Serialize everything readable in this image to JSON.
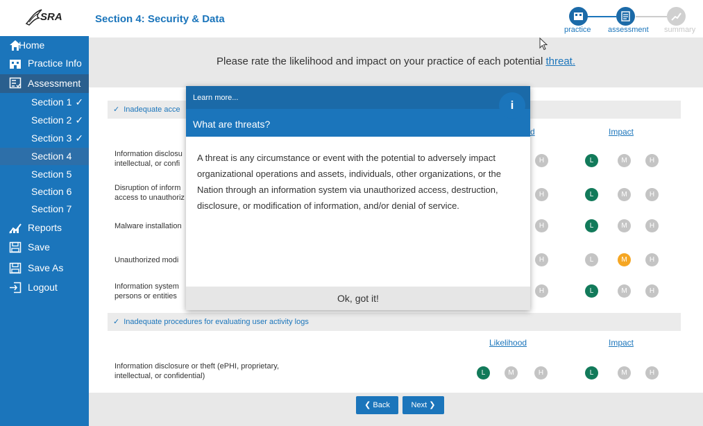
{
  "app": {
    "logo_text": "SRA",
    "section_title": "Section 4: Security & Data"
  },
  "steps": [
    {
      "label": "practice",
      "state": "done"
    },
    {
      "label": "assessment",
      "state": "active"
    },
    {
      "label": "summary",
      "state": "inactive"
    }
  ],
  "sidebar": {
    "items": [
      {
        "label": "Home",
        "icon": "home-icon"
      },
      {
        "label": "Practice Info",
        "icon": "building-icon"
      },
      {
        "label": "Assessment",
        "icon": "checklist-icon"
      },
      {
        "label": "Section 1",
        "check": "✓"
      },
      {
        "label": "Section 2",
        "check": "✓"
      },
      {
        "label": "Section 3",
        "check": "✓"
      },
      {
        "label": "Section 4"
      },
      {
        "label": "Section 5"
      },
      {
        "label": "Section 6"
      },
      {
        "label": "Section 7"
      },
      {
        "label": "Reports",
        "icon": "chart-icon"
      },
      {
        "label": "Save",
        "icon": "save-icon"
      },
      {
        "label": "Save As",
        "icon": "save-as-icon"
      },
      {
        "label": "Logout",
        "icon": "logout-icon"
      }
    ]
  },
  "banner": {
    "text": "Please rate the likelihood and impact on your practice of each potential ",
    "link": "threat."
  },
  "groups": [
    {
      "title": "Inadequate acce",
      "likelihood_label": "d",
      "impact_label": "Impact",
      "rows": [
        {
          "text": "Information disclosu\nintellectual, or confi",
          "impact": "L"
        },
        {
          "text": "Disruption of inform\naccess to unauthoriz",
          "impact": "L"
        },
        {
          "text": "Malware installation",
          "impact": "L"
        },
        {
          "text": "Unauthorized modi",
          "impact": "M"
        },
        {
          "text": "Information system\npersons or entities",
          "impact": "L"
        }
      ]
    },
    {
      "title": "Inadequate procedures for evaluating user activity logs",
      "likelihood_label": "Likelihood",
      "impact_label": "Impact",
      "rows": [
        {
          "text": "Information disclosure or theft (ePHI, proprietary,\nintellectual, or confidential)",
          "likelihood": "L",
          "impact": "L"
        }
      ]
    }
  ],
  "circle_letters": {
    "low": "L",
    "medium": "M",
    "high": "H"
  },
  "modal": {
    "learn_more": "Learn more...",
    "title": "What are threats?",
    "info_icon": "i",
    "body": "A threat is any circumstance or event with the potential to adversely impact organizational operations and assets, individuals, other organizations, or the Nation through an information system via unauthorized access, destruction, disclosure, or modification of information, and/or denial of service.",
    "ok_label": "Ok, got it!"
  },
  "footer": {
    "back_label": "Back",
    "next_label": "Next"
  },
  "colors": {
    "brand": "#1b75bb",
    "selected_green": "#127a5a",
    "selected_orange": "#f5a623",
    "unselected": "#c4c4c4"
  }
}
